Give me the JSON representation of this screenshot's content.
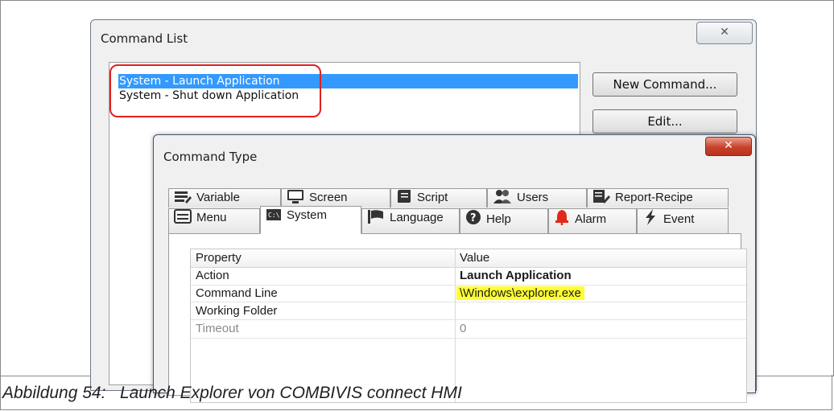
{
  "command_list": {
    "title": "Command List",
    "close_icon": "✕",
    "items": [
      "System - Launch Application",
      "System - Shut down Application"
    ],
    "buttons": {
      "new_command": "New Command...",
      "edit": "Edit..."
    }
  },
  "command_type": {
    "title": "Command Type",
    "close_icon": "✕",
    "tabs_row1": [
      {
        "label": "Variable",
        "icon": "variable-icon"
      },
      {
        "label": "Screen",
        "icon": "screen-icon"
      },
      {
        "label": "Script",
        "icon": "script-icon"
      },
      {
        "label": "Users",
        "icon": "users-icon"
      },
      {
        "label": "Report-Recipe",
        "icon": "report-recipe-icon"
      }
    ],
    "tabs_row2": [
      {
        "label": "Menu",
        "icon": "menu-icon"
      },
      {
        "label": "System",
        "icon": "system-icon",
        "active": true
      },
      {
        "label": "Language",
        "icon": "language-icon"
      },
      {
        "label": "Help",
        "icon": "help-icon"
      },
      {
        "label": "Alarm",
        "icon": "alarm-icon"
      },
      {
        "label": "Event",
        "icon": "event-icon"
      }
    ],
    "grid": {
      "headers": {
        "property": "Property",
        "value": "Value"
      },
      "rows": [
        {
          "property": "Action",
          "value": "Launch Application"
        },
        {
          "property": "Command Line",
          "value": "\\Windows\\explorer.exe"
        },
        {
          "property": "Working Folder",
          "value": ""
        },
        {
          "property": "Timeout",
          "value": "0"
        }
      ]
    }
  },
  "caption": "Abbildung 54:   Launch Explorer von COMBIVIS connect HMI",
  "colors": {
    "selection": "#3399ff",
    "highlight": "#ffff33",
    "annotation": "#e02020",
    "close_button": "#c8412a"
  }
}
